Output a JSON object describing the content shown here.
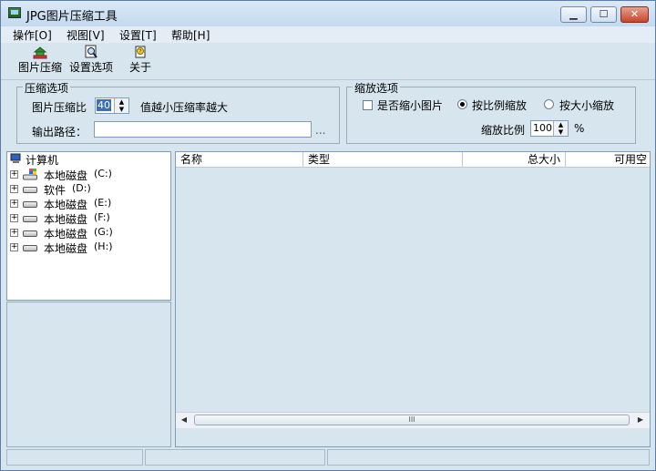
{
  "window": {
    "title": "JPG图片压缩工具"
  },
  "menu": {
    "items": [
      "操作[O]",
      "视图[V]",
      "设置[T]",
      "帮助[H]"
    ]
  },
  "toolbar": {
    "compress": "图片压缩",
    "settings": "设置选项",
    "about": "关于"
  },
  "compress_options": {
    "title": "压缩选项",
    "ratio_label": "图片压缩比",
    "ratio_value": "40",
    "hint": "值越小压缩率越大",
    "output_label": "输出路径：",
    "output_value": "",
    "browse": "..."
  },
  "scale_options": {
    "title": "缩放选项",
    "shrink_label": "是否缩小图片",
    "by_ratio_label": "按比例缩放",
    "by_size_label": "按大小缩放",
    "scale_label": "缩放比例",
    "scale_value": "100",
    "percent": "%"
  },
  "tree": {
    "root": "计算机",
    "drives": [
      {
        "name": "本地磁盘",
        "letter": "(C:)"
      },
      {
        "name": "软件",
        "letter": "(D:)"
      },
      {
        "name": "本地磁盘",
        "letter": "(E:)"
      },
      {
        "name": "本地磁盘",
        "letter": "(F:)"
      },
      {
        "name": "本地磁盘",
        "letter": "(G:)"
      },
      {
        "name": "本地磁盘",
        "letter": "(H:)"
      }
    ]
  },
  "list": {
    "columns": [
      "名称",
      "类型",
      "总大小",
      "可用空"
    ]
  },
  "scrollbar": {
    "grip": "III"
  }
}
